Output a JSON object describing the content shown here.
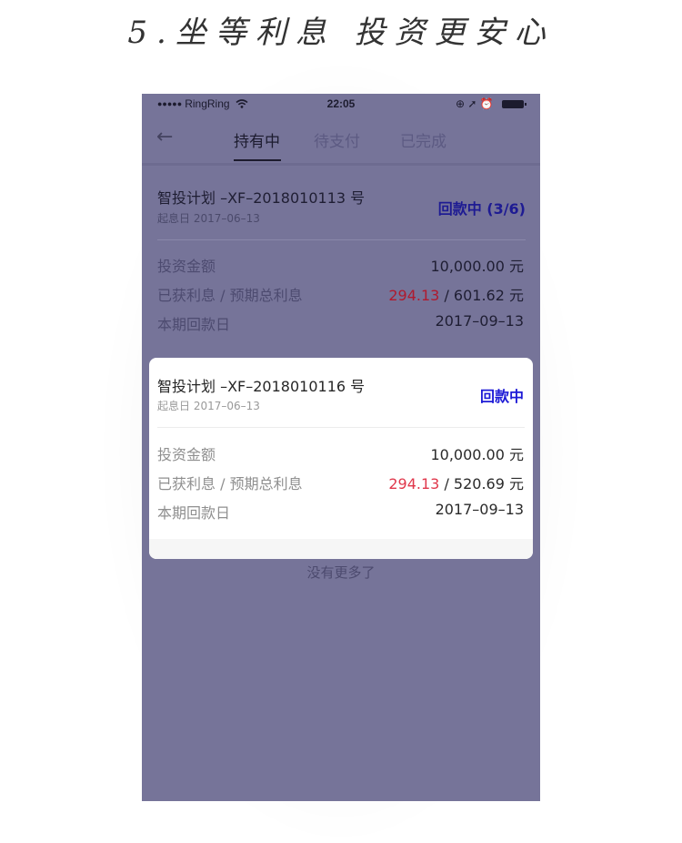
{
  "headline": "5.坐等利息 投资更安心",
  "status_bar": {
    "carrier_dots": "●●●●●",
    "carrier": "RingRing",
    "wifi_icon": "wifi-icon",
    "time": "22:05",
    "right_icons": "⊕ ➚ ⏰"
  },
  "nav": {
    "back_icon": "←",
    "tabs": [
      {
        "label": "持有中",
        "active": true
      },
      {
        "label": "待支付",
        "active": false
      },
      {
        "label": "已完成",
        "active": false
      }
    ]
  },
  "investments": [
    {
      "title": "智投计划 –XF–2018010113 号",
      "start_date": "起息日 2017–06–13",
      "status": "回款中 (3/6)",
      "rows": [
        {
          "label": "投资金额",
          "value": "10,000.00 元"
        },
        {
          "label": "已获利息 / 预期总利息",
          "earned": "294.13",
          "separator": " / ",
          "total": "601.62 元"
        },
        {
          "label": "本期回款日",
          "value": "2017–09–13"
        }
      ]
    },
    {
      "title": "智投计划 –XF–2018010116 号",
      "start_date": "起息日 2017–06–13",
      "status": "回款中",
      "rows": [
        {
          "label": "投资金额",
          "value": "10,000.00 元"
        },
        {
          "label": "已获利息 / 预期总利息",
          "earned": "294.13",
          "separator": " / ",
          "total": "520.69 元"
        },
        {
          "label": "本期回款日",
          "value": "2017–09–13"
        }
      ]
    }
  ],
  "footer_text": "没有更多了",
  "colors": {
    "overlay": "#767499",
    "accent_blue": "#1e1bd6",
    "earned_red": "#e0374b"
  }
}
